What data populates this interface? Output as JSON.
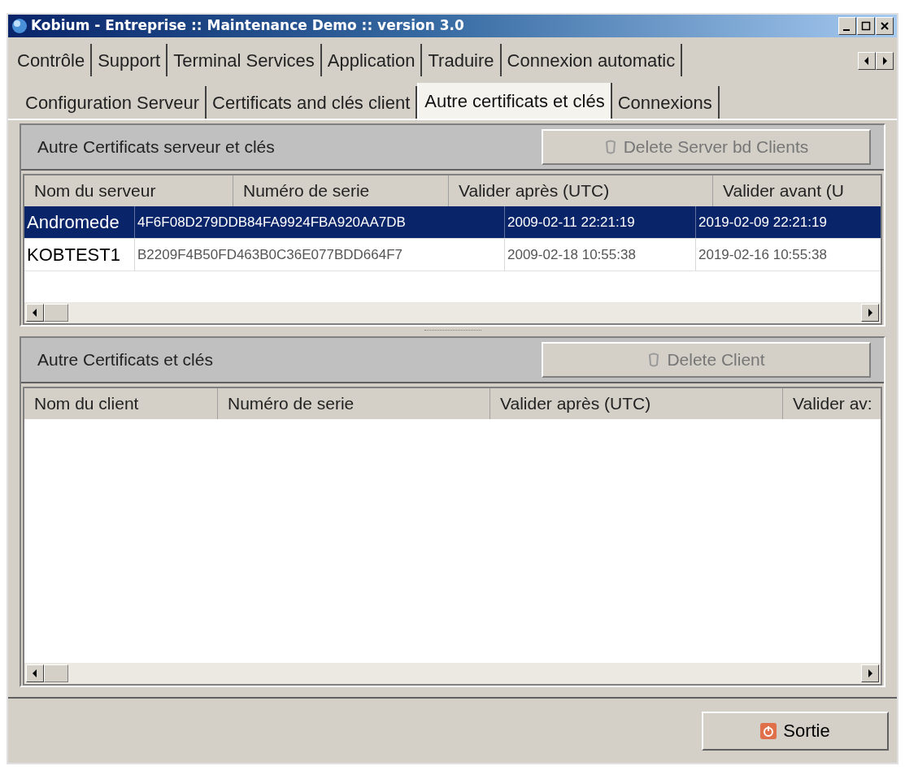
{
  "window": {
    "title": "Kobium - Entreprise :: Maintenance Demo :: version 3.0"
  },
  "main_tabs": [
    {
      "label": "Contrôle",
      "selected": false
    },
    {
      "label": "Support",
      "selected": false
    },
    {
      "label": "Terminal Services",
      "selected": false
    },
    {
      "label": "Application",
      "selected": false
    },
    {
      "label": "Traduire",
      "selected": false
    },
    {
      "label": "Connexion automatic",
      "selected": false
    }
  ],
  "sub_tabs": [
    {
      "label": "Configuration Serveur",
      "selected": false
    },
    {
      "label": "Certificats and clés client",
      "selected": false
    },
    {
      "label": "Autre certificats et clés",
      "selected": true
    },
    {
      "label": "Connexions",
      "selected": false
    }
  ],
  "server_section": {
    "title": "Autre Certificats serveur et clés",
    "button": {
      "label": "Delete Server bd Clients",
      "disabled": true
    },
    "columns": [
      "Nom du serveur",
      "Numéro de serie",
      "Valider après (UTC)",
      "Valider avant (U"
    ],
    "rows": [
      {
        "selected": true,
        "cells": [
          "Andromede",
          "4F6F08D279DDB84FA9924FBA920AA7DB",
          "2009-02-11 22:21:19",
          "2019-02-09 22:21:19"
        ]
      },
      {
        "selected": false,
        "cells": [
          "KOBTEST1",
          "B2209F4B50FD463B0C36E077BDD664F7",
          "2009-02-18 10:55:38",
          "2019-02-16 10:55:38"
        ]
      }
    ]
  },
  "client_section": {
    "title": "Autre Certificats et clés",
    "button": {
      "label": "Delete Client",
      "disabled": true
    },
    "columns": [
      "Nom du client",
      "Numéro de serie",
      "Valider après (UTC)",
      "Valider av:"
    ]
  },
  "footer": {
    "button": {
      "label": "Sortie"
    }
  }
}
